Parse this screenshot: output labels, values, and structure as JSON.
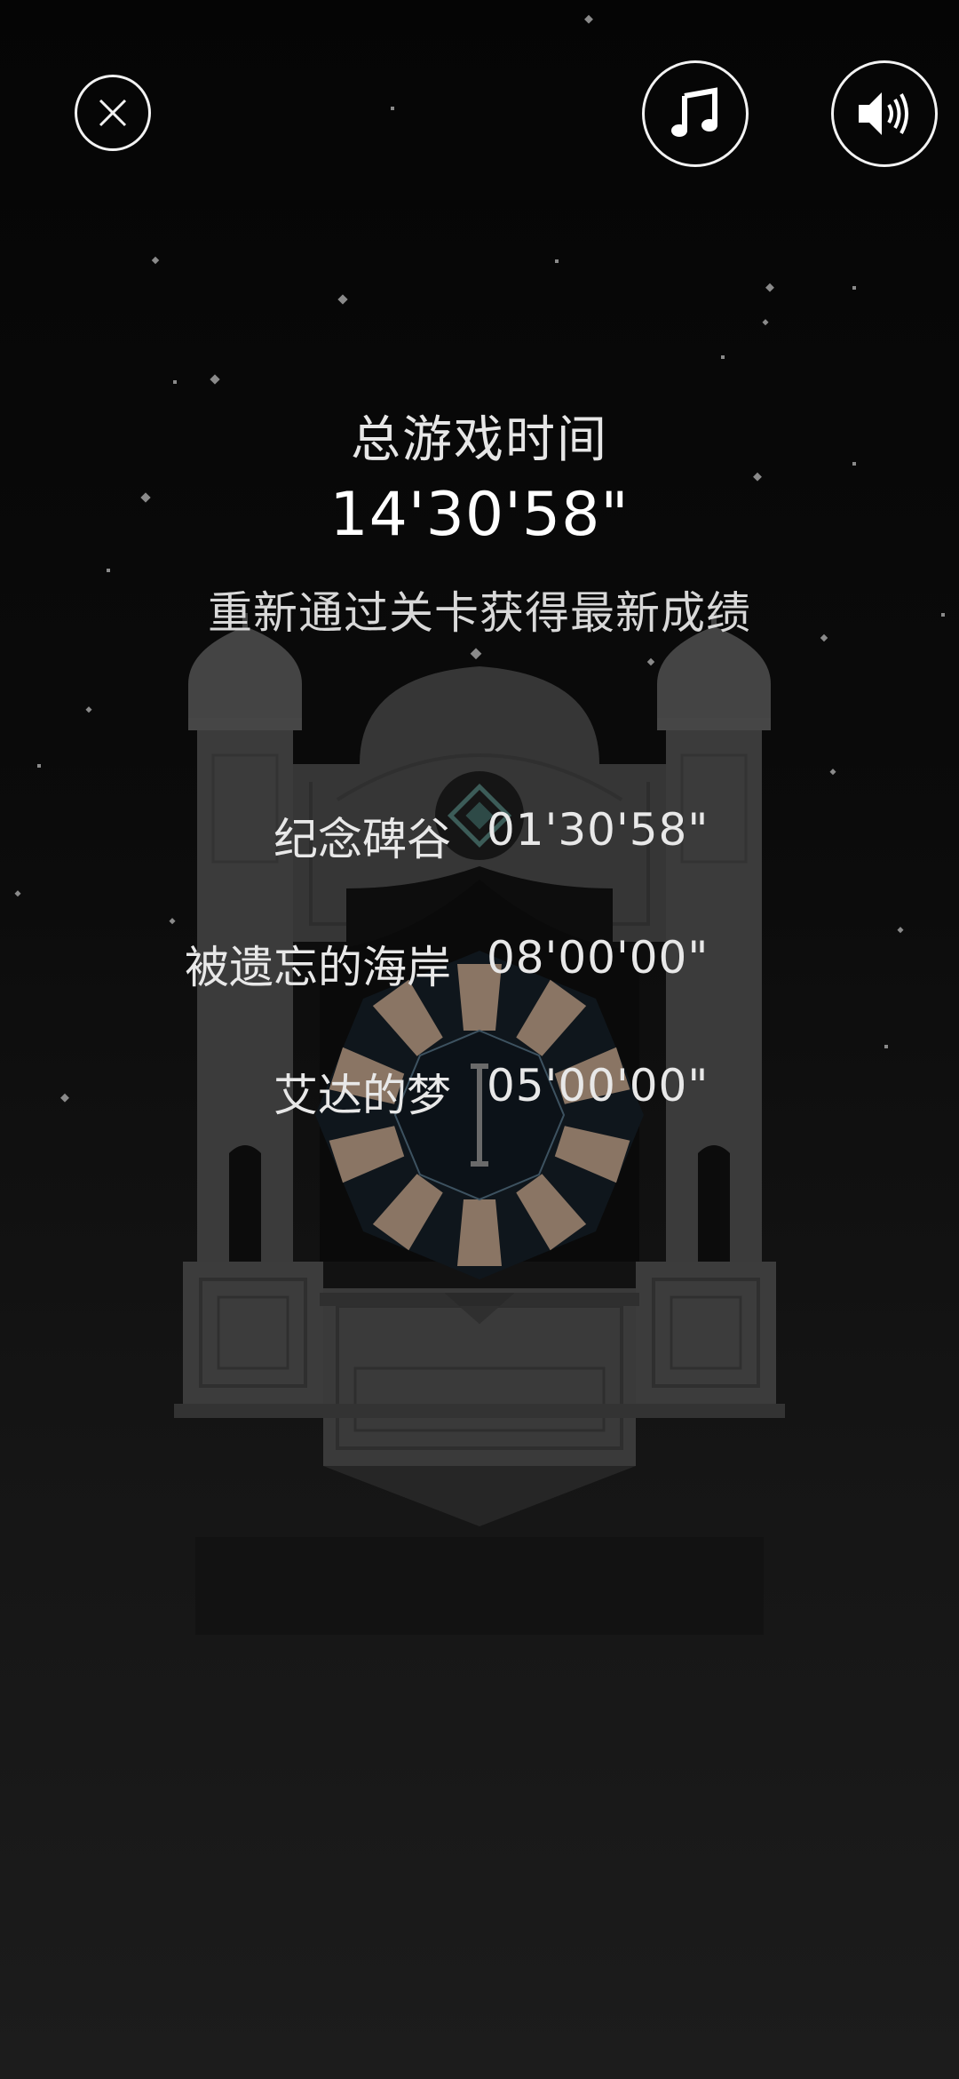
{
  "header": {
    "close_icon": "close-icon",
    "music_icon": "music-note-icon",
    "sound_icon": "speaker-icon"
  },
  "summary": {
    "total_label": "总游戏时间",
    "total_time": "14'30'58\"",
    "hint": "重新通过关卡获得最新成绩"
  },
  "records": [
    {
      "name": "纪念碑谷",
      "time": "01'30'58\""
    },
    {
      "name": "被遗忘的海岸",
      "time": "08'00'00\""
    },
    {
      "name": "艾达的梦",
      "time": "05'00'00\""
    }
  ],
  "colors": {
    "background": "#0a0a0a",
    "monument": "#3a3a3a",
    "text": "#e6e6e6",
    "wheel_light": "#8a7564",
    "wheel_dark": "#0f1820"
  }
}
